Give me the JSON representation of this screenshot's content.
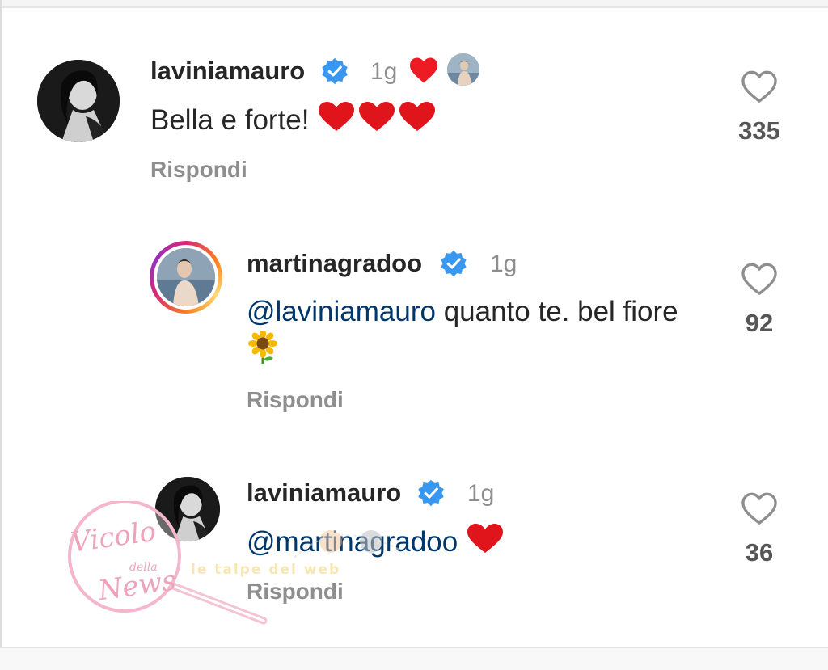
{
  "comments": [
    {
      "username": "laviniamauro",
      "verified": true,
      "time": "1g",
      "text": "Bella e forte! ",
      "emoji": "❤️❤️❤️",
      "liked_by_author": true,
      "reply_label": "Rispondi",
      "likes": "335"
    },
    {
      "username": "martinagradoo",
      "verified": true,
      "time": "1g",
      "mention": "@laviniamauro",
      "text": " quanto te. bel fiore",
      "emoji": "🌻",
      "reply_label": "Rispondi",
      "likes": "92"
    },
    {
      "username": "laviniamauro",
      "verified": true,
      "time": "1g",
      "mention": "@martinagradoo",
      "emoji": "❤️",
      "reply_label": "Rispondi",
      "likes": "36"
    }
  ],
  "watermark": {
    "brand_lines": [
      "Vicolo",
      "della",
      "News"
    ],
    "tagline": "le talpe del web"
  },
  "colors": {
    "verified_blue": "#3897f0",
    "heart_red": "#ed1c24",
    "mention_blue": "#00376b",
    "secondary_gray": "#8e8e8e"
  },
  "icons": [
    "verified-badge-icon",
    "heart-outline-icon",
    "red-heart-icon",
    "sunflower-emoji"
  ]
}
